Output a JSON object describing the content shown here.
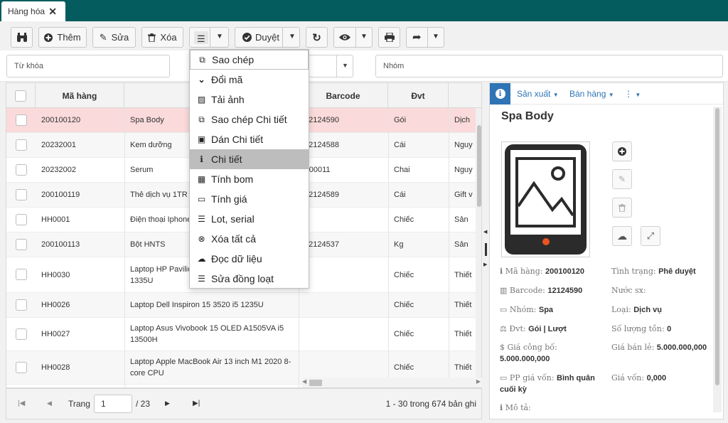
{
  "tab": {
    "title": "Hàng hóa",
    "close": "✕"
  },
  "toolbar": {
    "add": "Thêm",
    "edit": "Sửa",
    "delete": "Xóa",
    "approve": "Duyệt"
  },
  "filters": {
    "keyword_placeholder": "Từ khóa",
    "group_placeholder": "Nhóm"
  },
  "grid": {
    "columns": [
      "Mã hàng",
      "",
      "Barcode",
      "Đvt"
    ],
    "rows": [
      {
        "code": "200100120",
        "name": "Spa Body",
        "barcode": "12124590",
        "unit": "Gói",
        "extra": "Dịch"
      },
      {
        "code": "20232001",
        "name": "Kem dưỡng",
        "barcode": "12124588",
        "unit": "Cái",
        "extra": "Nguy"
      },
      {
        "code": "20232002",
        "name": "Serum",
        "barcode": "T00011",
        "unit": "Chai",
        "extra": "Nguy"
      },
      {
        "code": "200100119",
        "name": "Thẻ dịch vụ 1TR",
        "barcode": "12124589",
        "unit": "Cái",
        "extra": "Gift v"
      },
      {
        "code": "HH0001",
        "name": "Điện thoại Iphone",
        "barcode": "",
        "unit": "Chiếc",
        "extra": "Sản"
      },
      {
        "code": "200100113",
        "name": "Bột HNTS",
        "barcode": "12124537",
        "unit": "Kg",
        "extra": "Sản"
      },
      {
        "code": "HH0030",
        "name": "Laptop HP Pavilion 15 ... 1335U",
        "barcode": "",
        "unit": "Chiếc",
        "extra": "Thiết"
      },
      {
        "code": "HH0026",
        "name": "Laptop Dell Inspiron 15 3520 i5 1235U",
        "barcode": "",
        "unit": "Chiếc",
        "extra": "Thiết"
      },
      {
        "code": "HH0027",
        "name": "Laptop Asus Vivobook 15 OLED A1505VA i5 13500H",
        "barcode": "",
        "unit": "Chiếc",
        "extra": "Thiết"
      },
      {
        "code": "HH0028",
        "name": "Laptop Apple MacBook Air 13 inch M1 2020 8-core CPU",
        "barcode": "",
        "unit": "Chiếc",
        "extra": "Thiết"
      }
    ],
    "row7_line1": "Laptop HP Pavilio",
    "row7_line2": "1335U"
  },
  "pager": {
    "page_label": "Trang",
    "page_value": "1",
    "page_total": "/ 23",
    "summary": "1 - 30 trong 674 bản ghi"
  },
  "menu": {
    "items": [
      {
        "label": "Sao chép",
        "icon": "copy-icon",
        "glyph": "⧉"
      },
      {
        "label": "Đổi mã",
        "icon": "chevron-down-icon",
        "glyph": "⌄"
      },
      {
        "label": "Tải ảnh",
        "icon": "image-file-icon",
        "glyph": "▨"
      },
      {
        "label": "Sao chép Chi tiết",
        "icon": "copy-icon",
        "glyph": "⧉"
      },
      {
        "label": "Dán Chi tiết",
        "icon": "paste-icon",
        "glyph": "▣"
      },
      {
        "label": "Chi tiết",
        "icon": "info-icon",
        "glyph": "ℹ"
      },
      {
        "label": "Tính bom",
        "icon": "table-icon",
        "glyph": "▦"
      },
      {
        "label": "Tính giá",
        "icon": "money-icon",
        "glyph": "▭"
      },
      {
        "label": "Lot, serial",
        "icon": "list-icon",
        "glyph": "☰"
      },
      {
        "label": "Xóa tất cả",
        "icon": "remove-circle-icon",
        "glyph": "⊗"
      },
      {
        "label": "Đọc dữ liệu",
        "icon": "cloud-upload-icon",
        "glyph": "☁"
      },
      {
        "label": "Sửa đồng loạt",
        "icon": "list-icon",
        "glyph": "☰"
      }
    ]
  },
  "detail": {
    "tab_production": "Sản xuất",
    "tab_sales": "Bán hàng",
    "title": "Spa Body",
    "code_label": "Mã hàng:",
    "code_value": "200100120",
    "status_label": "Tình trạng:",
    "status_value": "Phê duyệt",
    "barcode_label": "Barcode:",
    "barcode_value": "12124590",
    "country_label": "Nước sx:",
    "group_label": "Nhóm:",
    "group_value": "Spa",
    "type_label": "Loại:",
    "type_value": "Dịch vụ",
    "unit_label": "Đvt:",
    "unit_value": "Gói | Lượt",
    "stock_label": "Số lượng tồn:",
    "stock_value": "0",
    "public_price_label": "$ Giá công bố:",
    "public_price_value": "5.000.000,000",
    "retail_price_label": "Giá bán lẻ:",
    "retail_price_value": "5.000.000,000",
    "cost_method_label": "PP giá vốn:",
    "cost_method_value": "Bình quân cuối kỳ",
    "cost_label": "Giá vốn:",
    "cost_value": "0,000",
    "desc_label": "Mô tả:"
  },
  "colors": {
    "topbar": "#045c5f",
    "accent": "#2f74b5",
    "selected_row": "#fadada",
    "menu_active": "#bdbdbd"
  }
}
